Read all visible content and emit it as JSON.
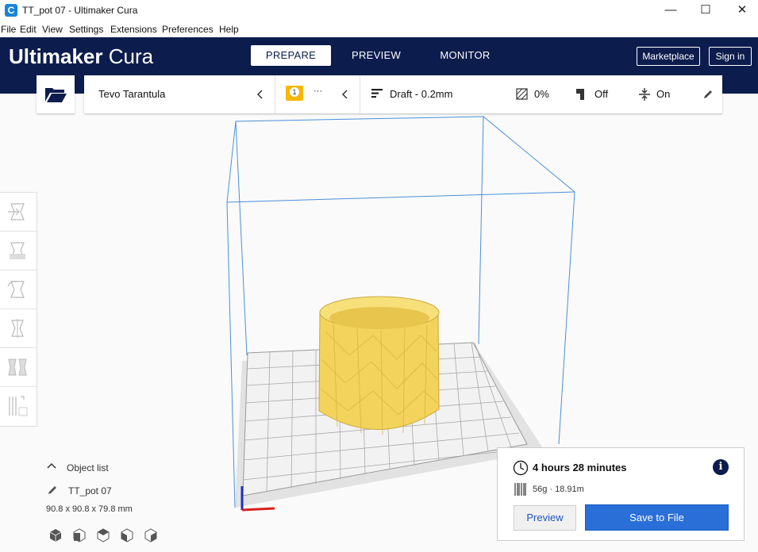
{
  "window": {
    "icon_letter": "C",
    "title": "TT_pot 07 - Ultimaker Cura",
    "minimize": "—",
    "maximize": "☐",
    "close": "✕"
  },
  "menu": [
    "File",
    "Edit",
    "View",
    "Settings",
    "Extensions",
    "Preferences",
    "Help"
  ],
  "header": {
    "logo_bold": "Ultimaker",
    "logo_light": " Cura",
    "tabs": [
      "PREPARE",
      "PREVIEW",
      "MONITOR"
    ],
    "active_tab": "PREPARE",
    "marketplace": "Marketplace",
    "signin": "Sign in"
  },
  "printer": {
    "name": "Tevo Tarantula",
    "extruder_badge": "1",
    "extruder_more": "···"
  },
  "print_settings": {
    "profile": "Draft - 0.2mm",
    "infill": "0%",
    "support": "Off",
    "adhesion": "On"
  },
  "objects": {
    "header": "Object list",
    "name": "TT_pot 07",
    "dimensions": "90.8 x 90.8 x 79.8 mm"
  },
  "print_panel": {
    "time": "4 hours 28 minutes",
    "material": "56g · 18.91m",
    "preview_label": "Preview",
    "save_label": "Save to File"
  },
  "colors": {
    "header_bg": "#0c1c4d",
    "accent": "#2a6fd8",
    "model": "#f7dd68",
    "volume_lines": "#4a90d9"
  }
}
